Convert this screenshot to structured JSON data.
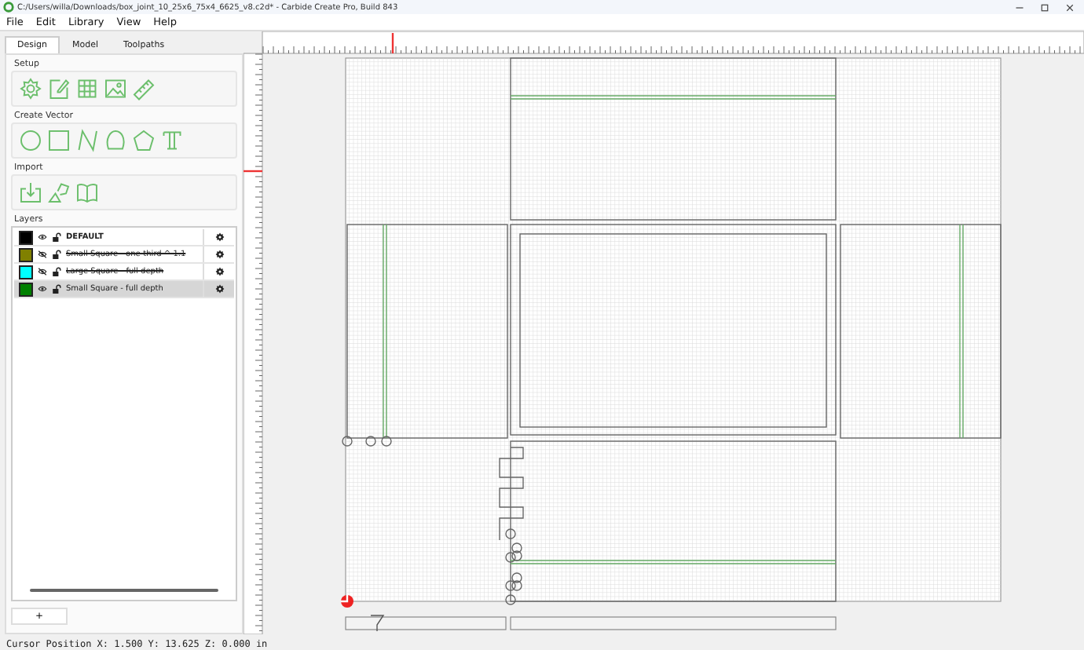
{
  "window": {
    "title": "C:/Users/willa/Downloads/box_joint_10_25x6_75x4_6625_v8.c2d* - Carbide Create Pro, Build 843"
  },
  "menu": [
    "File",
    "Edit",
    "Library",
    "View",
    "Help"
  ],
  "tabs": [
    {
      "label": "Design",
      "selected": true
    },
    {
      "label": "Model",
      "selected": false
    },
    {
      "label": "Toolpaths",
      "selected": false
    }
  ],
  "sections": [
    {
      "title": "Setup",
      "tools": [
        {
          "kind": "gear"
        },
        {
          "kind": "page-edit"
        },
        {
          "kind": "grid"
        },
        {
          "kind": "image"
        },
        {
          "kind": "ruler"
        }
      ]
    },
    {
      "title": "Create Vector",
      "tools": [
        {
          "kind": "circle"
        },
        {
          "kind": "rectangle"
        },
        {
          "kind": "polyline"
        },
        {
          "kind": "curve"
        },
        {
          "kind": "polygon"
        },
        {
          "kind": "text"
        }
      ]
    },
    {
      "title": "Import",
      "tools": [
        {
          "kind": "import"
        },
        {
          "kind": "shapes"
        },
        {
          "kind": "book"
        }
      ]
    }
  ],
  "layers": {
    "title": "Layers",
    "items": [
      {
        "name": "DEFAULT",
        "color": "#000000",
        "visible": true,
        "current": true,
        "selected": false
      },
      {
        "name": "Small Square - one-third ^ 1.1",
        "color": "#808000",
        "visible": false,
        "current": false,
        "selected": false
      },
      {
        "name": "Large Square - full depth",
        "color": "#00ffff",
        "visible": false,
        "current": false,
        "selected": false
      },
      {
        "name": "Small Square - full depth",
        "color": "#008000",
        "visible": true,
        "current": false,
        "selected": true
      }
    ]
  },
  "add_button": "+",
  "status_bar": "Cursor Position X: 1.500 Y: 13.625 Z: 0.000 in"
}
